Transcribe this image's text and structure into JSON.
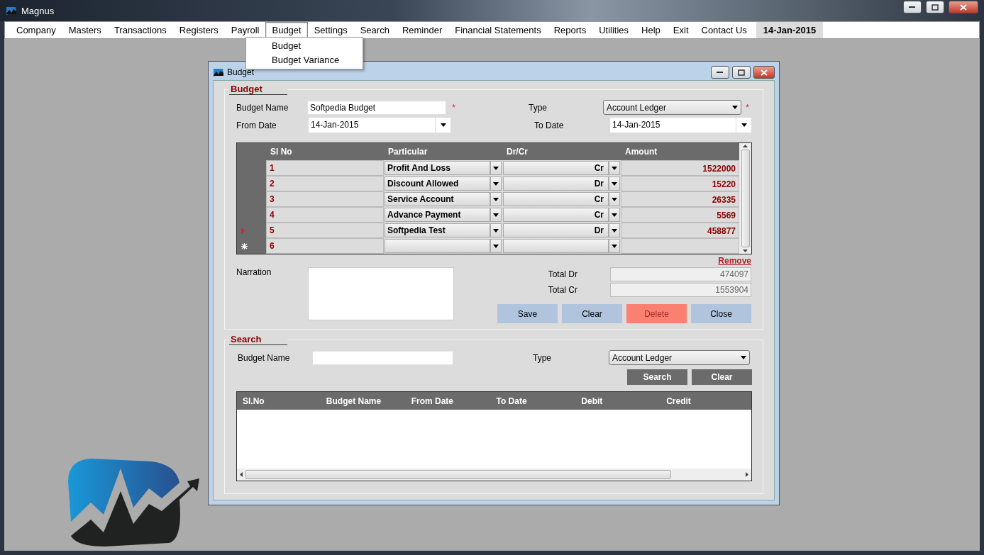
{
  "window": {
    "title": "Magnus"
  },
  "menu": [
    {
      "label": "Company",
      "selected": false
    },
    {
      "label": "Masters",
      "selected": false
    },
    {
      "label": "Transactions",
      "selected": false
    },
    {
      "label": "Registers",
      "selected": false
    },
    {
      "label": "Payroll",
      "selected": false
    },
    {
      "label": "Budget",
      "selected": true
    },
    {
      "label": "Settings",
      "selected": false
    },
    {
      "label": "Search",
      "selected": false
    },
    {
      "label": "Reminder",
      "selected": false
    },
    {
      "label": "Financial Statements",
      "selected": false
    },
    {
      "label": "Reports",
      "selected": false
    },
    {
      "label": "Utilities",
      "selected": false
    },
    {
      "label": "Help",
      "selected": false
    },
    {
      "label": "Exit",
      "selected": false
    },
    {
      "label": "Contact Us",
      "selected": false
    }
  ],
  "menu_date": "14-Jan-2015",
  "open_menu": [
    "Budget",
    "Budget Variance"
  ],
  "dialog": {
    "title": "Budget",
    "budget": {
      "heading": "Budget",
      "name_label": "Budget Name",
      "name_value": "Softpedia Budget",
      "required_mark": "*",
      "type_label": "Type",
      "type_value": "Account Ledger",
      "type_required_mark": "*",
      "from_label": "From Date",
      "from_value": "14-Jan-2015",
      "to_label": "To Date",
      "to_value": "14-Jan-2015",
      "columns": [
        "Sl No",
        "Particular",
        "Dr/Cr",
        "Amount"
      ],
      "rows": [
        {
          "kind": "entry",
          "selected": false,
          "sl": "1",
          "particular": "Profit And Loss",
          "drcr": "Cr",
          "amount": "1522000"
        },
        {
          "kind": "entry",
          "selected": false,
          "sl": "2",
          "particular": "Discount Allowed",
          "drcr": "Dr",
          "amount": "15220"
        },
        {
          "kind": "entry",
          "selected": false,
          "sl": "3",
          "particular": "Service Account",
          "drcr": "Cr",
          "amount": "26335"
        },
        {
          "kind": "entry",
          "selected": false,
          "sl": "4",
          "particular": "Advance Payment",
          "drcr": "Cr",
          "amount": "5569"
        },
        {
          "kind": "entry",
          "selected": true,
          "sl": "5",
          "particular": "Softpedia Test",
          "drcr": "Dr",
          "amount": "458877"
        },
        {
          "kind": "new",
          "selected": false,
          "sl": "6"
        }
      ],
      "remove": "Remove",
      "narration_label": "Narration",
      "total_dr_label": "Total Dr",
      "total_dr": "474097",
      "total_cr_label": "Total Cr",
      "total_cr": "1553904",
      "buttons": [
        {
          "label": "Save",
          "kind": "normal"
        },
        {
          "label": "Clear",
          "kind": "normal"
        },
        {
          "label": "Delete",
          "kind": "danger"
        },
        {
          "label": "Close",
          "kind": "normal"
        }
      ]
    },
    "search": {
      "heading": "Search",
      "name_label": "Budget Name",
      "type_label": "Type",
      "type_value": "Account Ledger",
      "buttons": [
        "Search",
        "Clear"
      ],
      "columns": [
        "Sl.No",
        "Budget Name",
        "From Date",
        "To Date",
        "Debit",
        "Credit"
      ]
    }
  }
}
